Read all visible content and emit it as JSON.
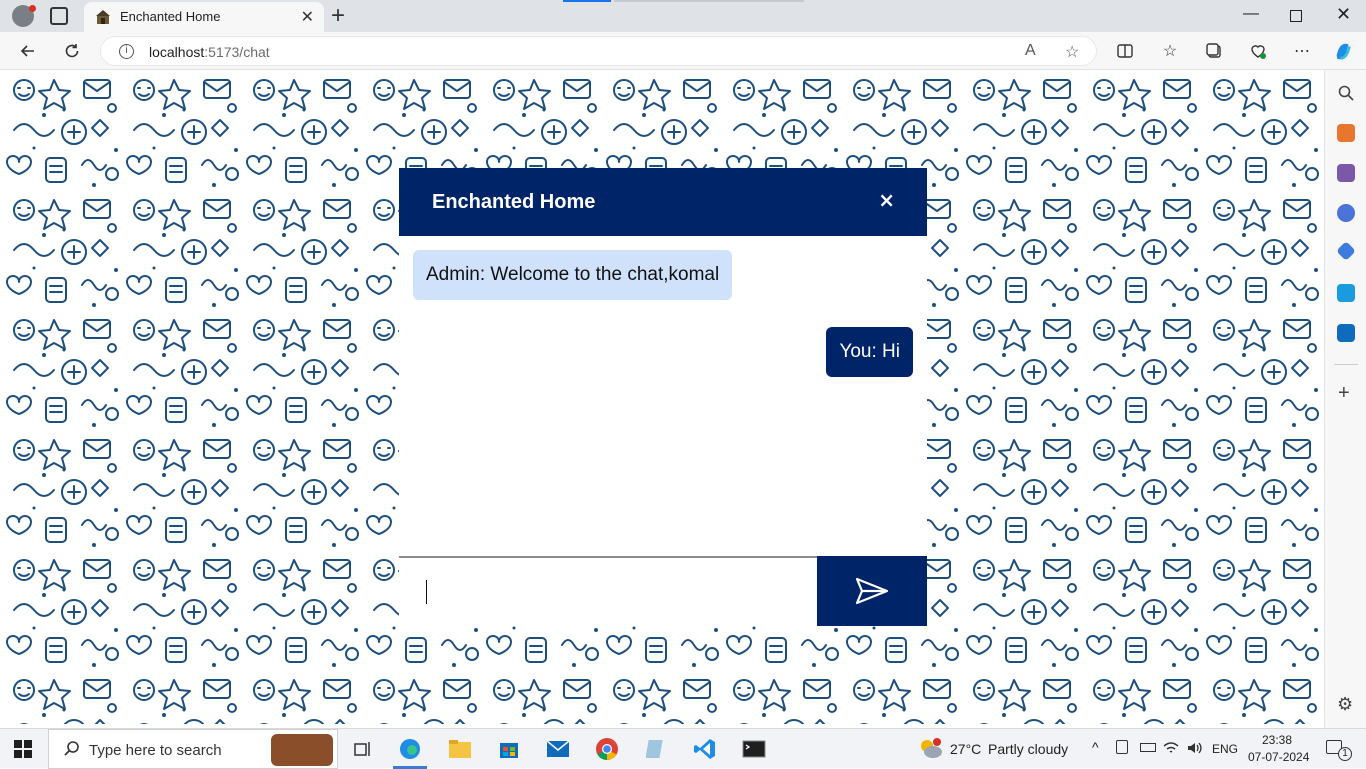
{
  "browser": {
    "tab_title": "Enchanted Home",
    "url_host": "localhost",
    "url_path": ":5173/chat"
  },
  "chat": {
    "title": "Enchanted Home",
    "close_label": "×",
    "messages": [
      {
        "sender": "admin",
        "text": "Admin: Welcome to the chat,komal"
      },
      {
        "sender": "you",
        "text": "You: Hi"
      }
    ],
    "input_value": "",
    "header_color": "#002468",
    "admin_bubble_color": "#cfe1fb"
  },
  "taskbar": {
    "search_placeholder": "Type here to search",
    "weather": {
      "temp": "27°C",
      "condition": "Partly cloudy"
    },
    "language": "ENG",
    "time": "23:38",
    "date": "07-07-2024",
    "notifications": "1"
  },
  "icons": [
    "profile-icon",
    "tab-actions-icon",
    "back-icon",
    "refresh-icon",
    "info-icon",
    "read-aloud-icon",
    "favorite-star-icon",
    "split-screen-icon",
    "favorites-icon",
    "collections-icon",
    "browser-essentials-icon",
    "more-icon",
    "copilot-icon",
    "send-icon",
    "windows-start-icon",
    "search-icon"
  ]
}
